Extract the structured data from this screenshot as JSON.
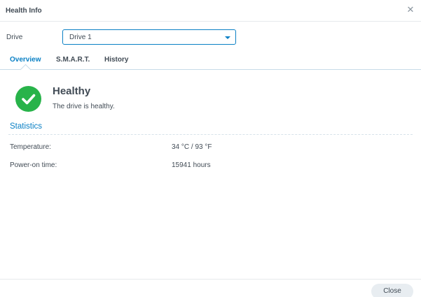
{
  "window": {
    "title": "Health Info",
    "close_glyph": "✕"
  },
  "drive": {
    "label": "Drive",
    "selected": "Drive 1"
  },
  "tabs": [
    {
      "label": "Overview",
      "active": true
    },
    {
      "label": "S.M.A.R.T.",
      "active": false
    },
    {
      "label": "History",
      "active": false
    }
  ],
  "status": {
    "icon": "check-circle-icon",
    "title": "Healthy",
    "description": "The drive is healthy.",
    "color": "#28b34a"
  },
  "statistics": {
    "heading": "Statistics",
    "rows": [
      {
        "label": "Temperature:",
        "value": "34 °C / 93 °F"
      },
      {
        "label": "Power-on time:",
        "value": "15941 hours"
      }
    ]
  },
  "footer": {
    "close_label": "Close"
  },
  "colors": {
    "accent": "#0a80c5",
    "success": "#28b34a",
    "text": "#414b55"
  }
}
